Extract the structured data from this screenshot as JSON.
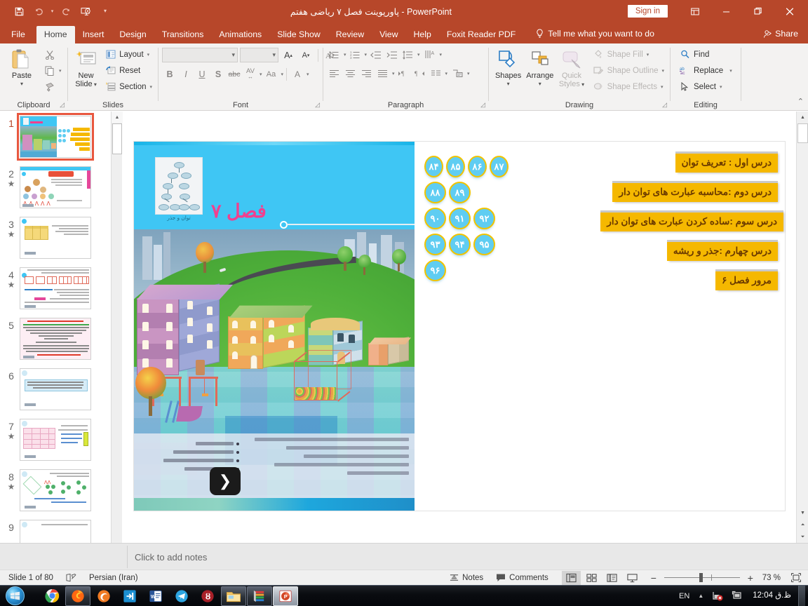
{
  "window": {
    "title": "پاورپوینت فصل ۷ ریاضی هفتم  -  PowerPoint",
    "signin_label": "Sign in",
    "qat": [
      {
        "name": "save",
        "glyph": "ὋE"
      },
      {
        "name": "undo",
        "glyph": "↶"
      },
      {
        "name": "redo",
        "glyph": "↻"
      },
      {
        "name": "start-slideshow",
        "glyph": "▷"
      },
      {
        "name": "customize-qat",
        "glyph": "▾"
      }
    ],
    "buttons": {
      "ribbon_display": "☷",
      "minimize": "─",
      "restore": "❐",
      "close": "✕"
    }
  },
  "tabs": [
    {
      "label": "File",
      "active": false
    },
    {
      "label": "Home",
      "active": true
    },
    {
      "label": "Insert",
      "active": false
    },
    {
      "label": "Design",
      "active": false
    },
    {
      "label": "Transitions",
      "active": false
    },
    {
      "label": "Animations",
      "active": false
    },
    {
      "label": "Slide Show",
      "active": false
    },
    {
      "label": "Review",
      "active": false
    },
    {
      "label": "View",
      "active": false
    },
    {
      "label": "Help",
      "active": false
    },
    {
      "label": "Foxit Reader PDF",
      "active": false
    }
  ],
  "tell_me": "Tell me what you want to do",
  "share_label": "Share",
  "ribbon": {
    "clipboard": {
      "label": "Clipboard",
      "paste": "Paste",
      "cut": "Cut",
      "copy": "Copy",
      "format_painter": "Format Painter"
    },
    "slides": {
      "label": "Slides",
      "new_slide": "New\nSlide",
      "new_slide_line1": "New",
      "new_slide_line2": "Slide",
      "layout": "Layout",
      "reset": "Reset",
      "section": "Section"
    },
    "font": {
      "label": "Font",
      "font_name": "",
      "font_size": "",
      "bold": "B",
      "italic": "I",
      "underline": "U",
      "shadow": "S",
      "strikethrough": "abc",
      "char_spacing": "AV",
      "change_case": "Aa",
      "font_color": "A",
      "grow_font": "A",
      "shrink_font": "A",
      "clear_formatting": "A"
    },
    "paragraph": {
      "label": "Paragraph"
    },
    "drawing": {
      "label": "Drawing",
      "shapes": "Shapes",
      "arrange": "Arrange",
      "quick_styles_l1": "Quick",
      "quick_styles_l2": "Styles",
      "shape_fill": "Shape Fill",
      "shape_outline": "Shape Outline",
      "shape_effects": "Shape Effects"
    },
    "editing": {
      "label": "Editing",
      "find": "Find",
      "replace": "Replace",
      "select": "Select"
    }
  },
  "thumbnails": [
    {
      "number": "1",
      "starred": false,
      "selected": true
    },
    {
      "number": "2",
      "starred": true,
      "selected": false
    },
    {
      "number": "3",
      "starred": true,
      "selected": false
    },
    {
      "number": "4",
      "starred": true,
      "selected": false
    },
    {
      "number": "5",
      "starred": false,
      "selected": false
    },
    {
      "number": "6",
      "starred": false,
      "selected": false
    },
    {
      "number": "7",
      "starred": true,
      "selected": false
    },
    {
      "number": "8",
      "starred": true,
      "selected": false
    },
    {
      "number": "9",
      "starred": false,
      "selected": false
    }
  ],
  "slide": {
    "chapter_title": "فصل ۷",
    "chapter_subtitle": "توان و جذر",
    "page_dots": [
      [
        "۸۴",
        "۸۵",
        "۸۶",
        "۸۷"
      ],
      [
        "۸۸",
        "۸۹"
      ],
      [
        "۹۰",
        "۹۱",
        "۹۲"
      ],
      [
        "۹۳",
        "۹۴",
        "۹۵"
      ],
      [
        "۹۶"
      ]
    ],
    "lessons": [
      "درس اول : تعریف توان",
      "درس دوم :محاسبه عبارت های توان دار",
      "درس سوم :ساده کردن عبارت های توان دار",
      "درس چهارم :جذر و ریشه",
      "مرور فصل ۶"
    ],
    "colors": {
      "header_blue": "#3fc6f4",
      "chapter_pink": "#f0408f",
      "lesson_orange": "#f5b800",
      "dot_blue": "#5fcdf2",
      "dot_ring": "#f2c300"
    }
  },
  "notes": {
    "placeholder": "Click to add notes"
  },
  "status": {
    "slide_counter": "Slide 1 of 80",
    "language": "Persian (Iran)",
    "notes_label": "Notes",
    "comments_label": "Comments",
    "zoom_level": "73 %",
    "zoom_out": "−",
    "zoom_in": "+"
  },
  "taskbar": {
    "apps": [
      {
        "name": "chrome",
        "label": "Chrome"
      },
      {
        "name": "firefox",
        "label": "Firefox"
      },
      {
        "name": "edge",
        "label": "Edge"
      },
      {
        "name": "idm",
        "label": "IDM"
      },
      {
        "name": "word",
        "label": "Word"
      },
      {
        "name": "telegram",
        "label": "Telegram"
      },
      {
        "name": "bitcoin-app",
        "label": "App"
      },
      {
        "name": "file-explorer",
        "label": "File Explorer"
      },
      {
        "name": "winrar",
        "label": "WinRAR"
      },
      {
        "name": "powerpoint",
        "label": "PowerPoint"
      }
    ],
    "tray": {
      "language": "EN",
      "show_hidden": "▲",
      "clock": "12:04 ظ.ق"
    }
  }
}
